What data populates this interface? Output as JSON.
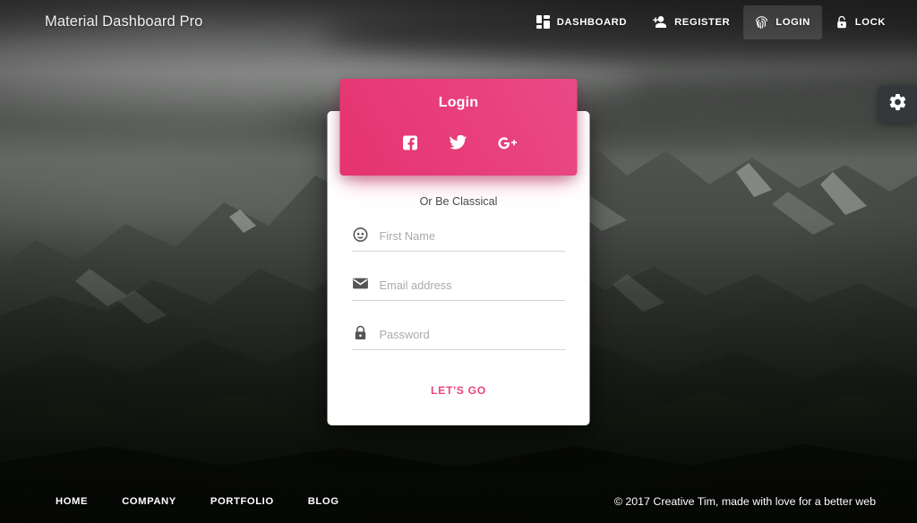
{
  "navbar": {
    "brand": "Material Dashboard Pro",
    "items": [
      {
        "label": "DASHBOARD",
        "icon": "dashboard-grid-icon",
        "active": false
      },
      {
        "label": "REGISTER",
        "icon": "person-add-icon",
        "active": false
      },
      {
        "label": "LOGIN",
        "icon": "fingerprint-icon",
        "active": true
      },
      {
        "label": "LOCK",
        "icon": "lock-open-icon",
        "active": false
      }
    ]
  },
  "settings_tab": {
    "icon": "gear-icon"
  },
  "card": {
    "title": "Login",
    "social": [
      {
        "name": "facebook",
        "glyph": "facebook-icon"
      },
      {
        "name": "twitter",
        "glyph": "twitter-icon"
      },
      {
        "name": "google",
        "glyph": "google-plus-icon"
      }
    ],
    "divider_text": "Or Be Classical",
    "fields": [
      {
        "icon": "face-icon",
        "placeholder": "First Name",
        "value": ""
      },
      {
        "icon": "email-icon",
        "placeholder": "Email address",
        "value": ""
      },
      {
        "icon": "lock-icon",
        "placeholder": "Password",
        "value": ""
      }
    ],
    "submit_label": "Let's Go"
  },
  "footer": {
    "links": [
      "Home",
      "Company",
      "Portfolio",
      "Blog"
    ],
    "copyright": "© 2017 Creative Tim, made with love for a better web"
  },
  "colors": {
    "accent_pink": "#e5336f",
    "accent_pink_light": "#ea4a86",
    "nav_active_bg": "rgba(255,255,255,0.13)",
    "gear_tab_bg": "#34383a",
    "card_bg": "#ffffff",
    "placeholder": "#aaaaaa"
  }
}
